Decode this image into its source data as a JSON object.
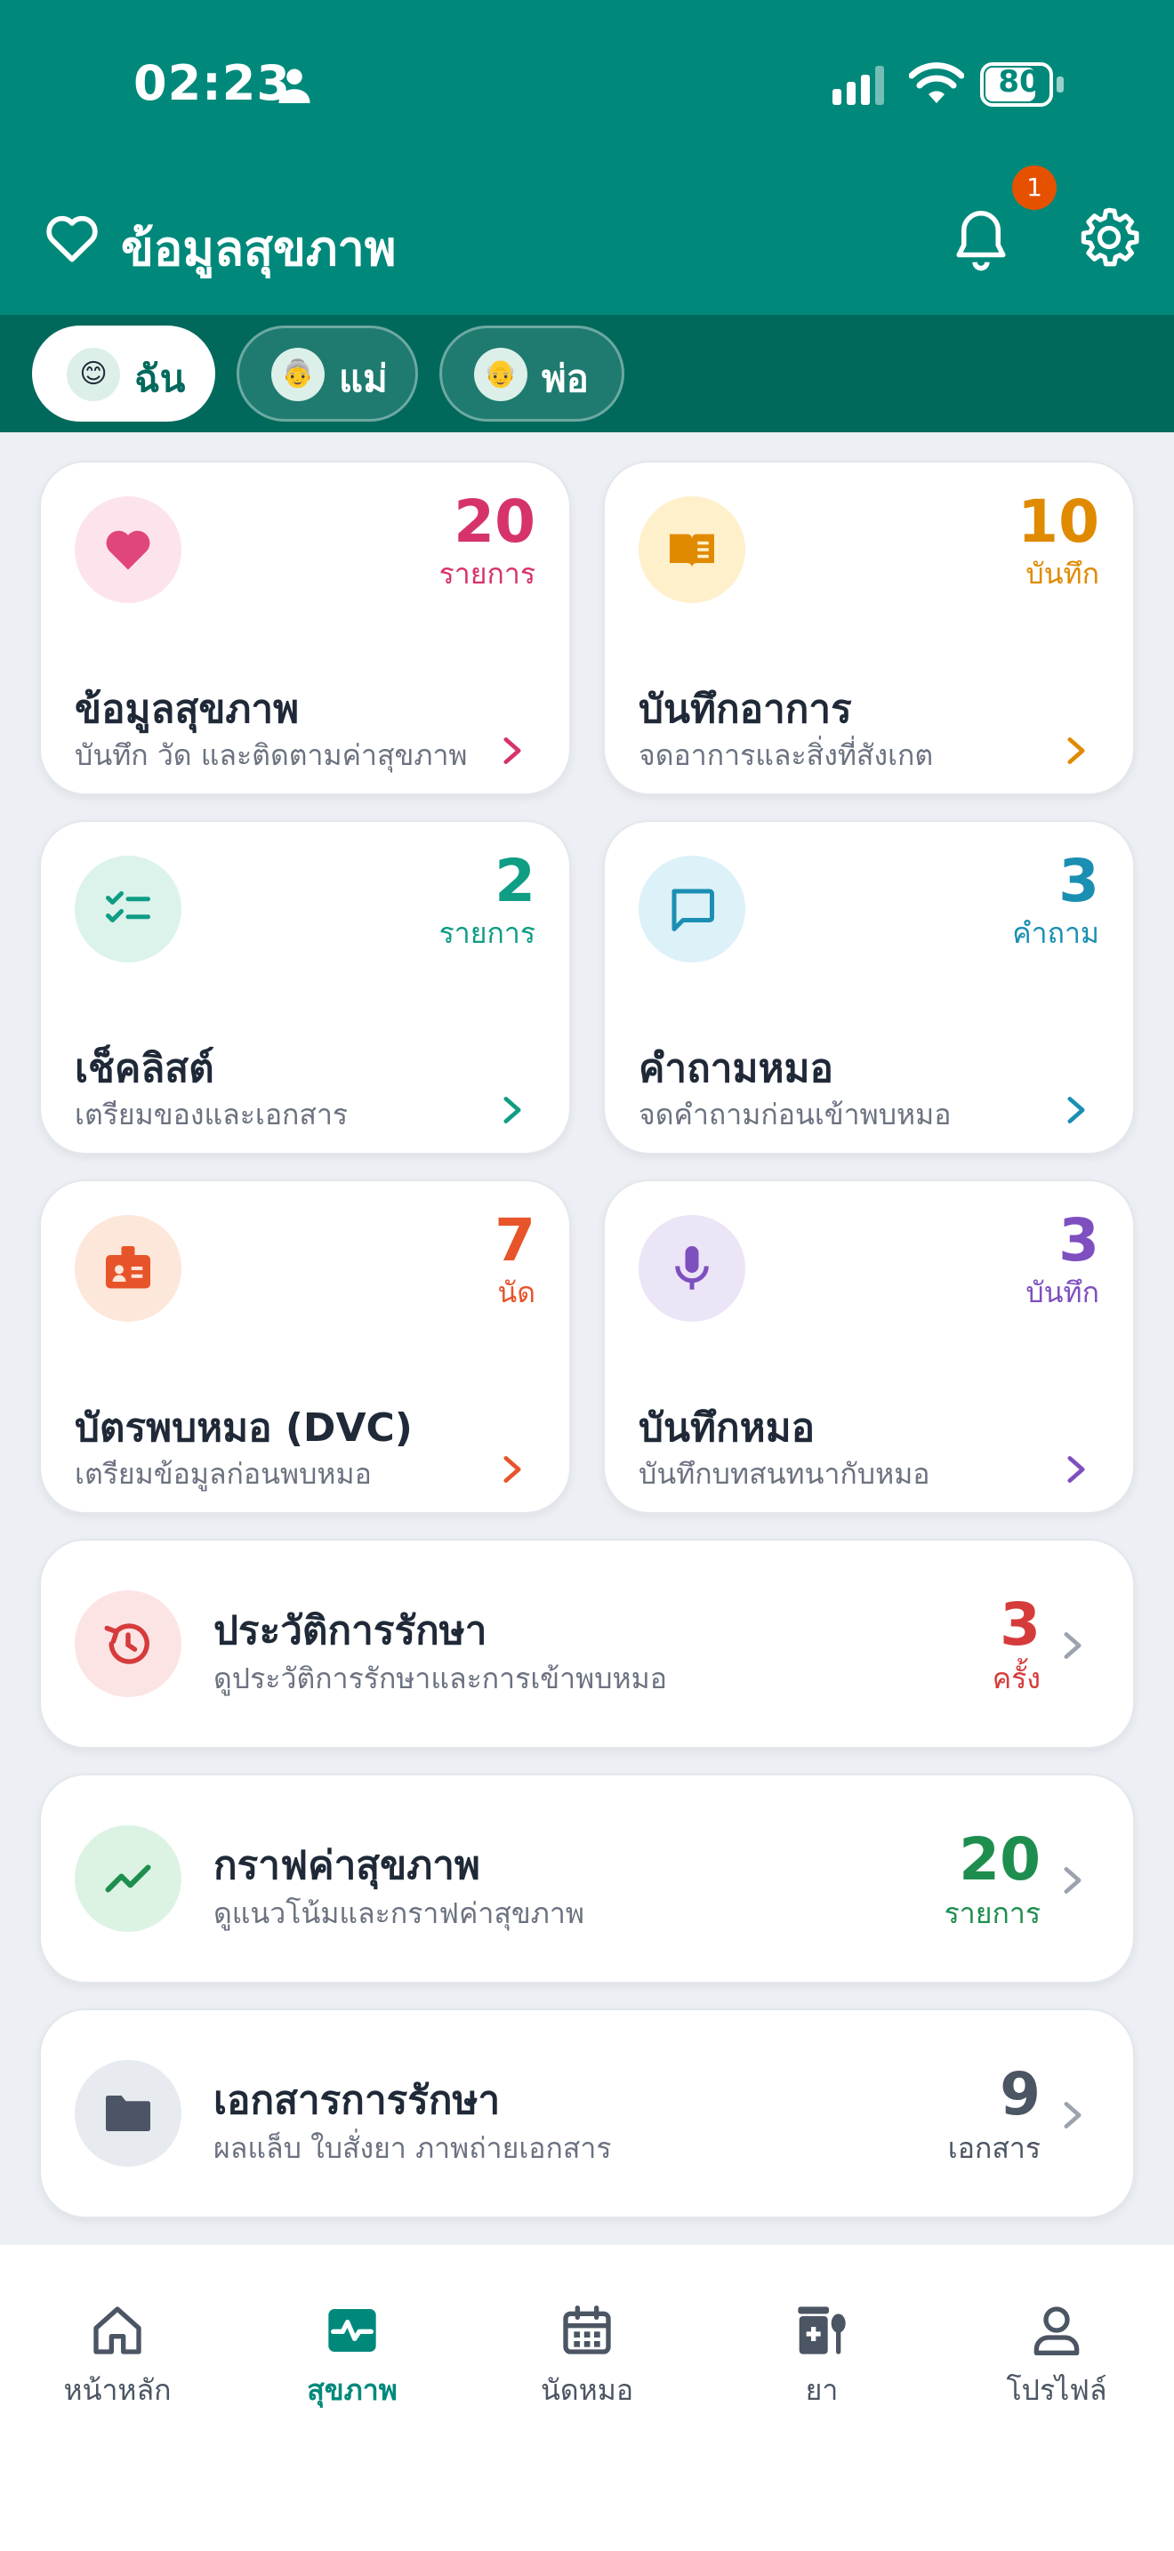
{
  "status": {
    "time": "02:23",
    "battery": "80"
  },
  "header": {
    "title": "ข้อมูลสุขภาพ",
    "notification_count": "1"
  },
  "profiles": [
    {
      "label": "ฉัน",
      "avatar": "😊",
      "active": true
    },
    {
      "label": "แม่",
      "avatar": "👵",
      "active": false
    },
    {
      "label": "พ่อ",
      "avatar": "👴",
      "active": false
    }
  ],
  "grid_cards": [
    {
      "title": "ข้อมูลสุขภาพ",
      "subtitle": "บันทึก วัด และติดตามค่าสุขภาพ",
      "count": "20",
      "unit": "รายการ",
      "icon": "heart-icon",
      "color": "#d6336c",
      "bg": "#fde4ec"
    },
    {
      "title": "บันทึกอาการ",
      "subtitle": "จดอาการและสิ่งที่สังเกต",
      "count": "10",
      "unit": "บันทึก",
      "icon": "book-icon",
      "color": "#e08a00",
      "bg": "#fff0cc"
    },
    {
      "title": "เช็คลิสต์",
      "subtitle": "เตรียมของและเอกสาร",
      "count": "2",
      "unit": "รายการ",
      "icon": "checklist-icon",
      "color": "#0f9d84",
      "bg": "#dcf3ec"
    },
    {
      "title": "คำถามหมอ",
      "subtitle": "จดคำถามก่อนเข้าพบหมอ",
      "count": "3",
      "unit": "คำถาม",
      "icon": "chat-icon",
      "color": "#1b8fb3",
      "bg": "#dcf1f8"
    },
    {
      "title": "บัตรพบหมอ (DVC)",
      "subtitle": "เตรียมข้อมูลก่อนพบหมอ",
      "count": "7",
      "unit": "นัด",
      "icon": "id-badge-icon",
      "color": "#e8542a",
      "bg": "#fde6da"
    },
    {
      "title": "บันทึกหมอ",
      "subtitle": "บันทึกบทสนทนากับหมอ",
      "count": "3",
      "unit": "บันทึก",
      "icon": "microphone-icon",
      "color": "#7e4fbf",
      "bg": "#ece4f7"
    }
  ],
  "wide_cards": [
    {
      "title": "ประวัติการรักษา",
      "subtitle": "ดูประวัติการรักษาและการเข้าพบหมอ",
      "count": "3",
      "unit": "ครั้ง",
      "icon": "history-icon",
      "color": "#d63b3b",
      "bg": "#fce4e4"
    },
    {
      "title": "กราฟค่าสุขภาพ",
      "subtitle": "ดูแนวโน้มและกราฟค่าสุขภาพ",
      "count": "20",
      "unit": "รายการ",
      "icon": "trend-chart-icon",
      "color": "#1e8e4e",
      "bg": "#dcf3e4"
    },
    {
      "title": "เอกสารการรักษา",
      "subtitle": "ผลแล็บ ใบสั่งยา ภาพถ่ายเอกสาร",
      "count": "9",
      "unit": "เอกสาร",
      "icon": "folder-icon",
      "color": "#4b5563",
      "bg": "#e7eaee"
    }
  ],
  "nav": [
    {
      "label": "หน้าหลัก",
      "icon": "home-icon",
      "active": false
    },
    {
      "label": "สุขภาพ",
      "icon": "health-monitor-icon",
      "active": true
    },
    {
      "label": "นัดหมอ",
      "icon": "calendar-icon",
      "active": false
    },
    {
      "label": "ยา",
      "icon": "medicine-icon",
      "active": false
    },
    {
      "label": "โปรไฟล์",
      "icon": "user-icon",
      "active": false
    }
  ]
}
